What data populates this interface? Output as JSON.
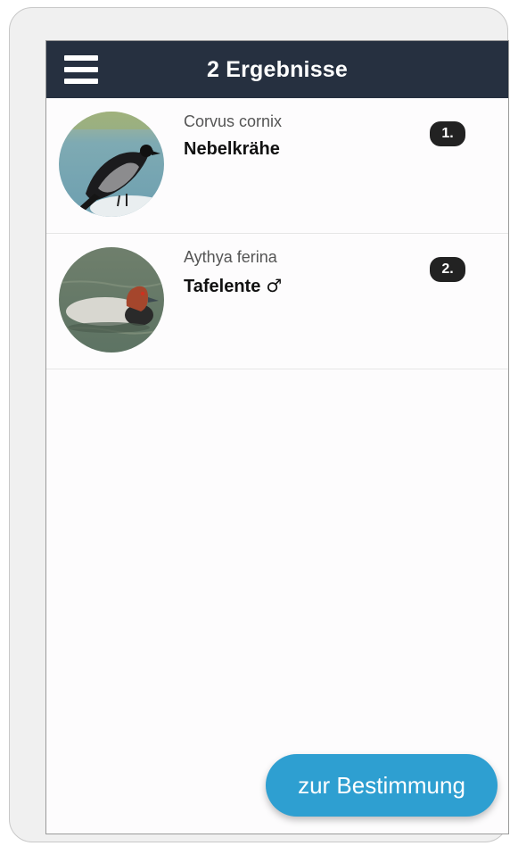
{
  "header": {
    "title": "2 Ergebnisse",
    "menu_icon": "hamburger-menu-icon",
    "background": "#263040"
  },
  "results": [
    {
      "rank": "1.",
      "scientific_name": "Corvus cornix",
      "common_name": "Nebelkrähe",
      "gender_symbol": "",
      "image": "hooded-crow-photo"
    },
    {
      "rank": "2.",
      "scientific_name": "Aythya ferina",
      "common_name": "Tafelente",
      "gender_symbol": "♂",
      "image": "common-pochard-photo"
    }
  ],
  "footer": {
    "cta_label": "zur Bestimmung",
    "cta_color": "#2e9fd1"
  }
}
